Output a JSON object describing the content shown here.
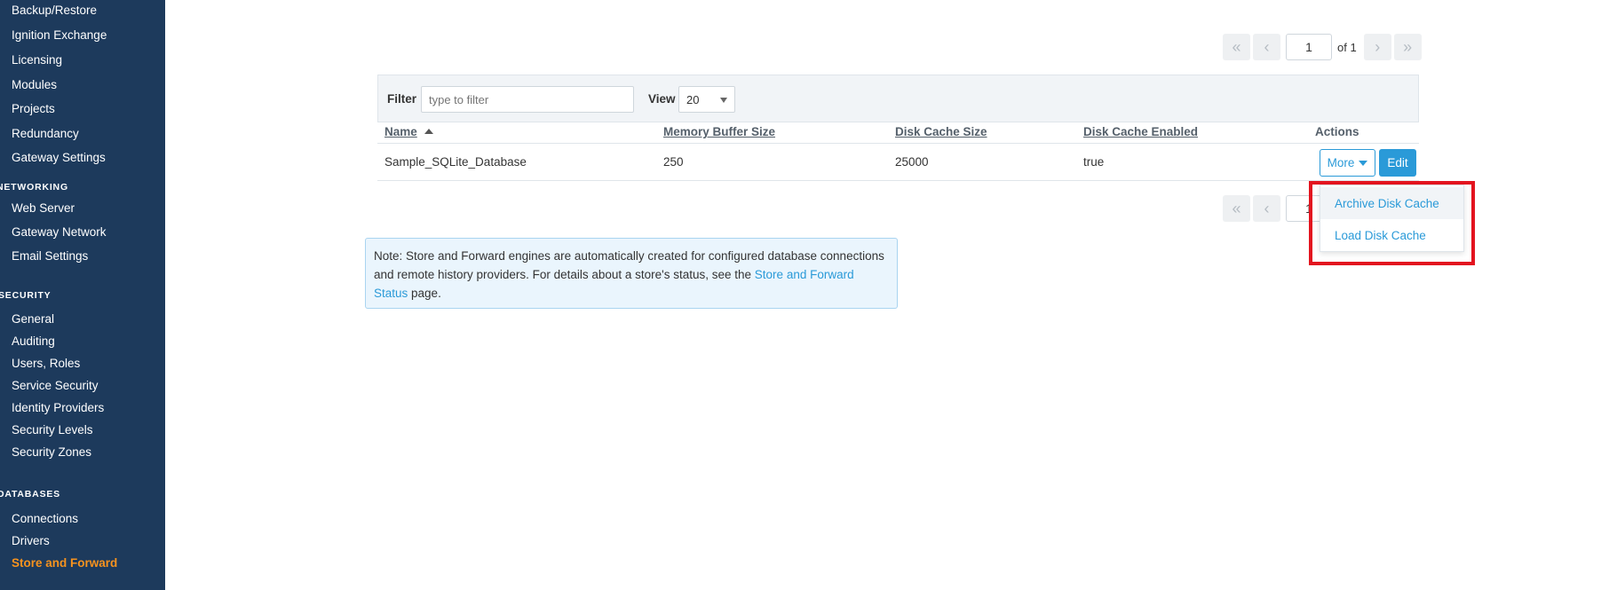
{
  "sidebar": {
    "items_top": [
      "Backup/Restore",
      "Ignition Exchange",
      "Licensing",
      "Modules",
      "Projects",
      "Redundancy",
      "Gateway Settings"
    ],
    "networking": {
      "title": "NETWORKING",
      "items": [
        "Web Server",
        "Gateway Network",
        "Email Settings"
      ]
    },
    "security": {
      "title": "SECURITY",
      "items": [
        "General",
        "Auditing",
        "Users, Roles",
        "Service Security",
        "Identity Providers",
        "Security Levels",
        "Security Zones"
      ]
    },
    "databases": {
      "title": "DATABASES",
      "items": [
        "Connections",
        "Drivers",
        "Store and Forward"
      ]
    },
    "active_item": "Store and Forward",
    "active_color": "#f7931e"
  },
  "pager_top": {
    "first": "«",
    "prev": "‹",
    "page": "1",
    "of_label": "of 1",
    "next": "›",
    "last": "»"
  },
  "pager_bottom": {
    "first": "«",
    "prev": "‹",
    "page": "1"
  },
  "filter": {
    "label": "Filter",
    "placeholder": "type to filter",
    "view_label": "View",
    "view_value": "20"
  },
  "table": {
    "columns": [
      "Name",
      "Memory Buffer Size",
      "Disk Cache Size",
      "Disk Cache Enabled",
      "Actions"
    ],
    "rows": [
      {
        "name": "Sample_SQLite_Database",
        "memory_buffer_size": "250",
        "disk_cache_size": "25000",
        "disk_cache_enabled": "true"
      }
    ],
    "more_label": "More",
    "edit_label": "Edit"
  },
  "more_menu": {
    "items": [
      "Archive Disk Cache",
      "Load Disk Cache"
    ]
  },
  "note": {
    "text_before": "Note: Store and Forward engines are automatically created for configured database connections and remote history providers. For details about a store's status, see the ",
    "link": "Store and Forward Status",
    "text_after": " page."
  },
  "colors": {
    "sidebar_bg": "#1d3a5c",
    "accent": "#2a9ad8",
    "highlight": "#e3141f"
  }
}
